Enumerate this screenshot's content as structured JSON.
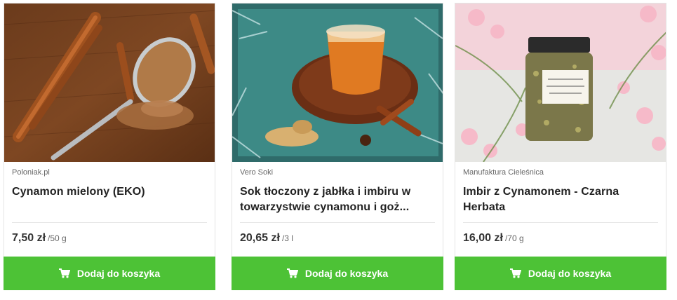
{
  "products": [
    {
      "vendor": "Poloniak.pl",
      "title": "Cynamon mielony (EKO)",
      "price": "7,50 zł",
      "unit": "/50 g",
      "button": "Dodaj do koszyka",
      "image_icon": "cinnamon-spoon-photo"
    },
    {
      "vendor": "Vero Soki",
      "title": "Sok tłoczony z jabłka i imbiru w towarzystwie cynamonu i goż...",
      "price": "20,65 zł",
      "unit": "/3 l",
      "button": "Dodaj do koszyka",
      "image_icon": "juice-glass-photo"
    },
    {
      "vendor": "Manufaktura Cieleśnica",
      "title": "Imbir z Cynamonem - Czarna Herbata",
      "price": "16,00 zł",
      "unit": "/70 g",
      "button": "Dodaj do koszyka",
      "image_icon": "tea-jar-photo"
    }
  ],
  "colors": {
    "button": "#4dc236",
    "text": "#222222",
    "muted": "#666666"
  }
}
